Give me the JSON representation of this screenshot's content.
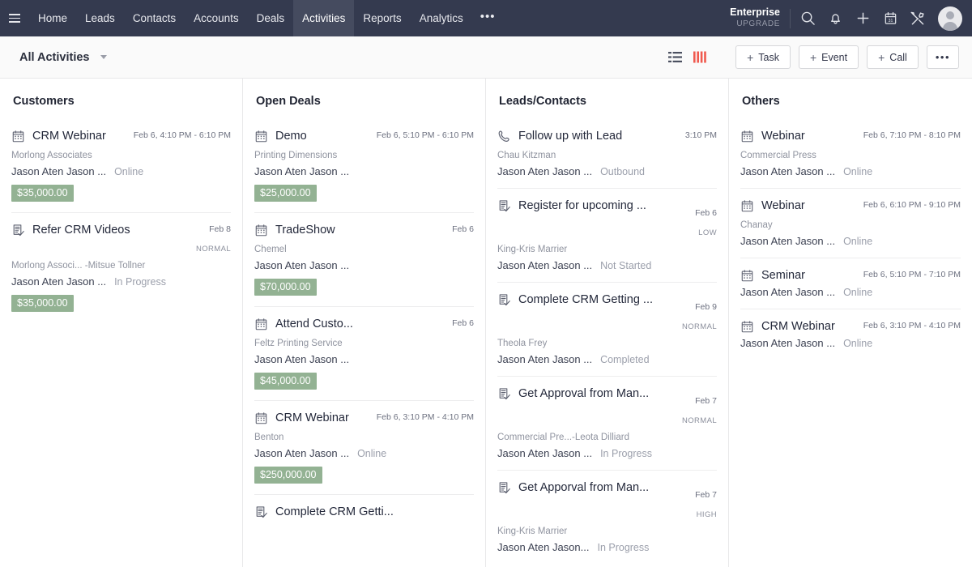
{
  "navbar": {
    "menu_icon": "hamburger-icon",
    "items": [
      {
        "label": "Home",
        "active": false
      },
      {
        "label": "Leads",
        "active": false
      },
      {
        "label": "Contacts",
        "active": false
      },
      {
        "label": "Accounts",
        "active": false
      },
      {
        "label": "Deals",
        "active": false
      },
      {
        "label": "Activities",
        "active": true
      },
      {
        "label": "Reports",
        "active": false
      },
      {
        "label": "Analytics",
        "active": false
      }
    ],
    "more_label": "•••",
    "plan_name": "Enterprise",
    "plan_upgrade": "UPGRADE",
    "icons": [
      "search-icon",
      "notifications-bell-icon",
      "add-icon",
      "calendar-icon",
      "setup-tools-icon"
    ],
    "avatar": "user-avatar"
  },
  "toolbar": {
    "view_title": "All Activities",
    "view_list_icon": "list-view-icon",
    "view_kanban_icon": "kanban-view-icon",
    "active_view": "kanban",
    "accent_color": "#f05a4f",
    "buttons": [
      {
        "label": "Task",
        "plus": "+"
      },
      {
        "label": "Event",
        "plus": "+"
      },
      {
        "label": "Call",
        "plus": "+"
      }
    ],
    "more_label": "•••"
  },
  "columns": [
    {
      "title": "Customers",
      "cards": [
        {
          "type": "event",
          "icon": "calendar-icon",
          "title": "CRM Webinar",
          "date": "Feb 6, 4:10 PM - 6:10 PM",
          "date_below": false,
          "priority": "",
          "company": "Morlong Associates",
          "owner": "Jason Aten Jason ...",
          "status": "Online",
          "amount": "$35,000.00"
        },
        {
          "type": "task",
          "icon": "task-icon",
          "title": "Refer CRM Videos",
          "date": "Feb 8",
          "date_below": false,
          "priority": "NORMAL",
          "company": "Morlong Associ... -Mitsue Tollner",
          "owner": "Jason Aten Jason ...",
          "status": "In Progress",
          "amount": "$35,000.00"
        }
      ]
    },
    {
      "title": "Open Deals",
      "cards": [
        {
          "type": "event",
          "icon": "calendar-icon",
          "title": "Demo",
          "date": "Feb 6, 5:10 PM - 6:10 PM",
          "date_below": false,
          "priority": "",
          "company": "Printing Dimensions",
          "owner": "Jason Aten Jason ...",
          "status": "",
          "amount": "$25,000.00"
        },
        {
          "type": "event",
          "icon": "calendar-icon",
          "title": "TradeShow",
          "date": "Feb 6",
          "date_below": false,
          "priority": "",
          "company": "Chemel",
          "owner": "Jason Aten Jason ...",
          "status": "",
          "amount": "$70,000.00"
        },
        {
          "type": "event",
          "icon": "calendar-icon",
          "title": "Attend Custo...",
          "date": "Feb 6",
          "date_below": false,
          "priority": "",
          "company": "Feltz Printing Service",
          "owner": "Jason Aten Jason ...",
          "status": "",
          "amount": "$45,000.00"
        },
        {
          "type": "event",
          "icon": "calendar-icon",
          "title": "CRM Webinar",
          "date": "Feb 6, 3:10 PM - 4:10 PM",
          "date_below": false,
          "priority": "",
          "company": "Benton",
          "owner": "Jason Aten Jason ...",
          "status": "Online",
          "amount": "$250,000.00"
        },
        {
          "type": "task",
          "icon": "task-icon",
          "title": "Complete CRM Getti...",
          "date": "",
          "date_below": false,
          "priority": "",
          "company": "",
          "owner": "",
          "status": "",
          "amount": ""
        }
      ]
    },
    {
      "title": "Leads/Contacts",
      "cards": [
        {
          "type": "call",
          "icon": "phone-icon",
          "title": "Follow up with Lead",
          "date": "3:10 PM",
          "date_below": false,
          "priority": "",
          "company": "Chau Kitzman",
          "owner": "Jason Aten Jason ...",
          "status": "Outbound",
          "amount": ""
        },
        {
          "type": "task",
          "icon": "task-icon",
          "title": "Register for upcoming ...",
          "date": "Feb 6",
          "date_below": true,
          "priority": "LOW",
          "company": "King-Kris Marrier",
          "owner": "Jason Aten Jason ...",
          "status": "Not Started",
          "amount": ""
        },
        {
          "type": "task",
          "icon": "task-icon",
          "title": "Complete CRM Getting ...",
          "date": "Feb 9",
          "date_below": true,
          "priority": "NORMAL",
          "company": "Theola Frey",
          "owner": "Jason Aten Jason ...",
          "status": "Completed",
          "amount": ""
        },
        {
          "type": "task",
          "icon": "task-icon",
          "title": "Get Approval from Man...",
          "date": "Feb 7",
          "date_below": true,
          "priority": "NORMAL",
          "company": "Commercial Pre...-Leota Dilliard",
          "owner": "Jason Aten Jason ...",
          "status": "In Progress",
          "amount": ""
        },
        {
          "type": "task",
          "icon": "task-icon",
          "title": "Get Apporval from Man...",
          "date": "Feb 7",
          "date_below": true,
          "priority": "HIGH",
          "company": "King-Kris Marrier",
          "owner": "Jason Aten Jason...",
          "status": "In Progress",
          "amount": ""
        }
      ]
    },
    {
      "title": "Others",
      "cards": [
        {
          "type": "event",
          "icon": "calendar-icon",
          "title": "Webinar",
          "date": "Feb 6, 7:10 PM - 8:10 PM",
          "date_below": false,
          "priority": "",
          "company": "Commercial Press",
          "owner": "Jason Aten Jason ...",
          "status": "Online",
          "amount": ""
        },
        {
          "type": "event",
          "icon": "calendar-icon",
          "title": "Webinar",
          "date": "Feb 6, 6:10 PM - 9:10 PM",
          "date_below": false,
          "priority": "",
          "company": "Chanay",
          "owner": "Jason Aten Jason ...",
          "status": "Online",
          "amount": ""
        },
        {
          "type": "event",
          "icon": "calendar-icon",
          "title": "Seminar",
          "date": "Feb 6, 5:10 PM - 7:10 PM",
          "date_below": false,
          "priority": "",
          "company": "",
          "owner": "Jason Aten Jason ...",
          "status": "Online",
          "amount": ""
        },
        {
          "type": "event",
          "icon": "calendar-icon",
          "title": "CRM Webinar",
          "date": "Feb 6, 3:10 PM - 4:10 PM",
          "date_below": false,
          "priority": "",
          "company": "",
          "owner": "Jason Aten Jason ...",
          "status": "Online",
          "amount": ""
        }
      ]
    }
  ]
}
